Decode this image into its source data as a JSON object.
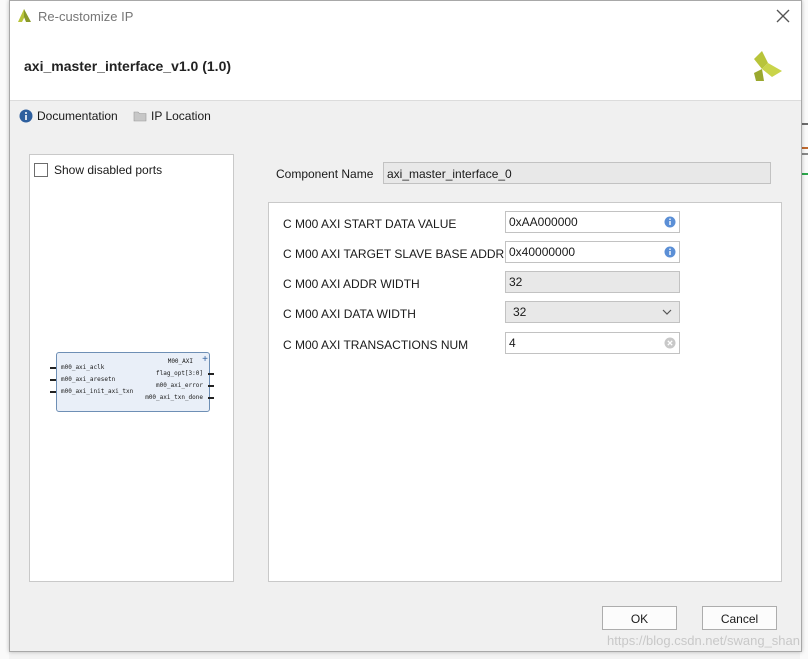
{
  "dialog": {
    "title": "Re-customize IP",
    "ip_name": "axi_master_interface_v1.0 (1.0)"
  },
  "links": [
    {
      "label": "Documentation",
      "icon": "info-icon"
    },
    {
      "label": "IP Location",
      "icon": "folder-icon"
    }
  ],
  "left_panel": {
    "show_disabled_ports_label": "Show disabled ports",
    "show_disabled_ports_checked": false,
    "block": {
      "left_ports": [
        "m00_axi_aclk",
        "m00_axi_aresetn",
        "m00_axi_init_axi_txn"
      ],
      "right_ports": [
        "M00_AXI",
        "flag_opt[3:0]",
        "m00_axi_error",
        "m00_axi_txn_done"
      ]
    }
  },
  "component": {
    "label": "Component Name",
    "value": "axi_master_interface_0"
  },
  "params": [
    {
      "label": "C M00 AXI START DATA VALUE",
      "value": "0xAA000000",
      "type": "text-info"
    },
    {
      "label": "C M00 AXI TARGET SLAVE BASE ADDR",
      "value": "0x40000000",
      "type": "text-info"
    },
    {
      "label": "C M00 AXI ADDR WIDTH",
      "value": "32",
      "type": "readonly"
    },
    {
      "label": "C M00 AXI DATA WIDTH",
      "value": "32",
      "type": "select"
    },
    {
      "label": "C M00 AXI TRANSACTIONS NUM",
      "value": "4",
      "type": "text-clear"
    }
  ],
  "buttons": {
    "ok": "OK",
    "cancel": "Cancel"
  },
  "watermark": "https://blog.csdn.net/swang_shan",
  "colors": {
    "accent": "#4a7fc1",
    "logo": "#b8c43a"
  }
}
